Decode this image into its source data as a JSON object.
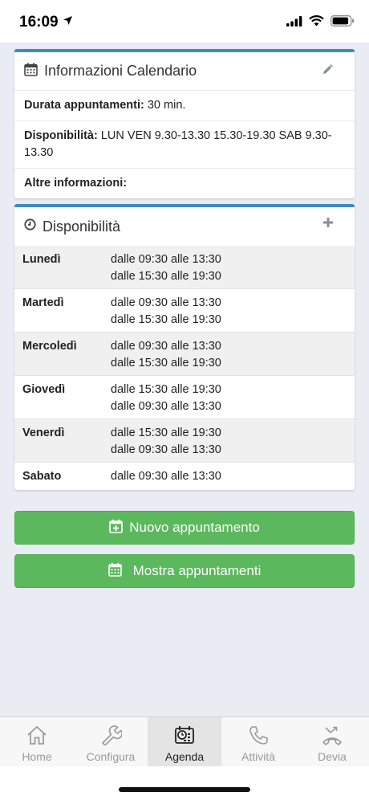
{
  "status_bar": {
    "time": "16:09"
  },
  "calendar_info": {
    "title": "Informazioni Calendario",
    "rows": [
      {
        "label": "Durata appuntamenti:",
        "value": " 30 min."
      },
      {
        "label": "Disponibilità:",
        "value": " LUN VEN 9.30-13.30 15.30-19.30 SAB 9.30-13.30"
      },
      {
        "label": "Altre informazioni:",
        "value": ""
      }
    ]
  },
  "availability": {
    "title": "Disponibilità",
    "days": [
      {
        "day": "Lunedì",
        "slots": [
          "dalle 09:30 alle 13:30",
          "dalle 15:30 alle 19:30"
        ]
      },
      {
        "day": "Martedì",
        "slots": [
          "dalle 09:30 alle 13:30",
          "dalle 15:30 alle 19:30"
        ]
      },
      {
        "day": "Mercoledì",
        "slots": [
          "dalle 09:30 alle 13:30",
          "dalle 15:30 alle 19:30"
        ]
      },
      {
        "day": "Giovedì",
        "slots": [
          "dalle 15:30 alle 19:30",
          "dalle 09:30 alle 13:30"
        ]
      },
      {
        "day": "Venerdì",
        "slots": [
          "dalle 15:30 alle 19:30",
          "dalle 09:30 alle 13:30"
        ]
      },
      {
        "day": "Sabato",
        "slots": [
          "dalle 09:30 alle 13:30"
        ]
      }
    ]
  },
  "buttons": {
    "new_appointment": "Nuovo appuntamento",
    "show_appointments": "Mostra appuntamenti"
  },
  "tabbar": {
    "tabs": [
      {
        "label": "Home",
        "icon": "home-icon"
      },
      {
        "label": "Configura",
        "icon": "wrench-icon"
      },
      {
        "label": "Agenda",
        "icon": "agenda-icon",
        "active": true
      },
      {
        "label": "Attività",
        "icon": "phone-icon"
      },
      {
        "label": "Devia",
        "icon": "call-divert-icon"
      }
    ]
  },
  "colors": {
    "accent": "#3c8dbc",
    "success": "#5cb85c",
    "background": "#e9ecf3"
  }
}
